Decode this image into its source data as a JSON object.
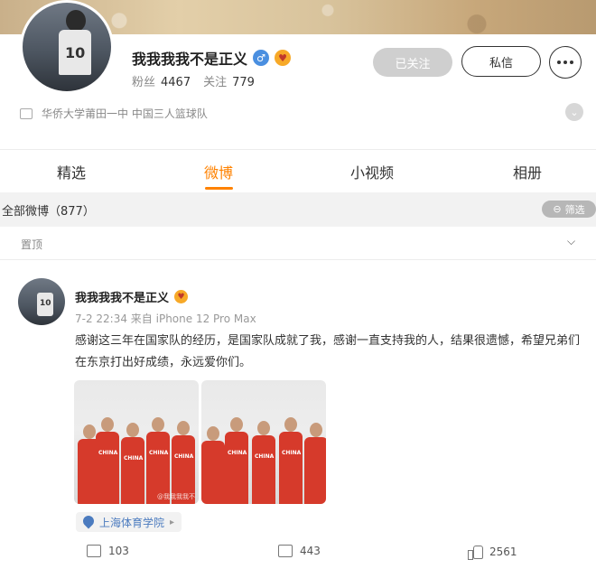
{
  "profile": {
    "name": "我我我我不是正义",
    "followers_label": "粉丝",
    "followers": "4467",
    "following_label": "关注",
    "following": "779",
    "school": "华侨大学莆田一中 中国三人篮球队",
    "jersey_number": "10",
    "gender_badge": "male-badge-icon",
    "emoji_badge": "emoji-badge-icon"
  },
  "buttons": {
    "followed": "已关注",
    "message": "私信",
    "more": "more-icon"
  },
  "tabs": [
    {
      "label": "精选",
      "active": false
    },
    {
      "label": "微博",
      "active": true
    },
    {
      "label": "小视频",
      "active": false
    },
    {
      "label": "相册",
      "active": false
    }
  ],
  "filter_bar": {
    "all_posts": "全部微博（877）",
    "filter": "筛选"
  },
  "pinned_label": "置顶",
  "post": {
    "author": "我我我我不是正义",
    "meta": "7-2 22:34 来自 iPhone 12 Pro Max",
    "text": "感谢这三年在国家队的经历，是国家队成就了我，感谢一直支持我的人，结果很遗憾，希望兄弟们在东京打出好成绩，永远爱你们。",
    "location": "上海体育学院",
    "reposts": "103",
    "comments": "443",
    "likes": "2561",
    "photo_label": "CHINA",
    "photo_caption": "@我我我我不"
  },
  "colors": {
    "accent": "#ff8200",
    "link": "#4b7bbf",
    "jersey_red": "#d63a2b"
  }
}
